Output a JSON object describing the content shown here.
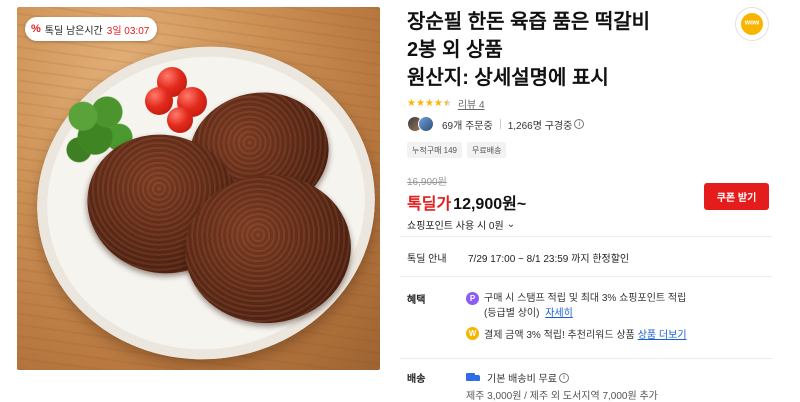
{
  "product": {
    "title_lines": [
      "장순필 한돈 육즙 품은 떡갈비",
      "2봉 외 상품",
      "원산지: 상세설명에 표시"
    ],
    "rating": 4.5,
    "review_link": "리뷰 4",
    "orders": "69개 주문중",
    "subscribers": "1,266명 구경중",
    "tags": [
      "누적구매 149",
      "무료배송"
    ],
    "original_price": "16,900원",
    "price_label": "톡딜가",
    "price": "12,900원~",
    "points_label": "쇼핑포인트 사용 시 0원"
  },
  "image": {
    "badge_label": "톡딜 남은시간",
    "badge_timer": "3일 03:07",
    "badge_icon": "percent-tag-icon"
  },
  "share_button": {
    "icon": "talk-share-icon",
    "text": "ʷᵒʷ"
  },
  "coupon_button": {
    "label": "쿠폰 받기"
  },
  "deal_info": {
    "label": "톡딜 안내",
    "value": "7/29 17:00 ~ 8/1 23:59 까지 한정할인"
  },
  "benefits": {
    "label": "혜택",
    "line1": "구매 시 스탬프 적립 및 최대 3% 쇼핑포인트 적립",
    "line1_sub": "(등급별 상이)",
    "line1_link": "자세히",
    "line2": "결제 금액 3% 적립! 추천리워드 상품",
    "line2_link": "상품 더보기"
  },
  "shipping": {
    "label": "배송",
    "line1": "기본 배송비 무료",
    "line2": "제주 3,000원 / 제주 외 도서지역 7,000원 추가"
  },
  "colors": {
    "accent_red": "#e41c1c",
    "star": "#ffb400",
    "link_blue": "#1a5fd6"
  }
}
